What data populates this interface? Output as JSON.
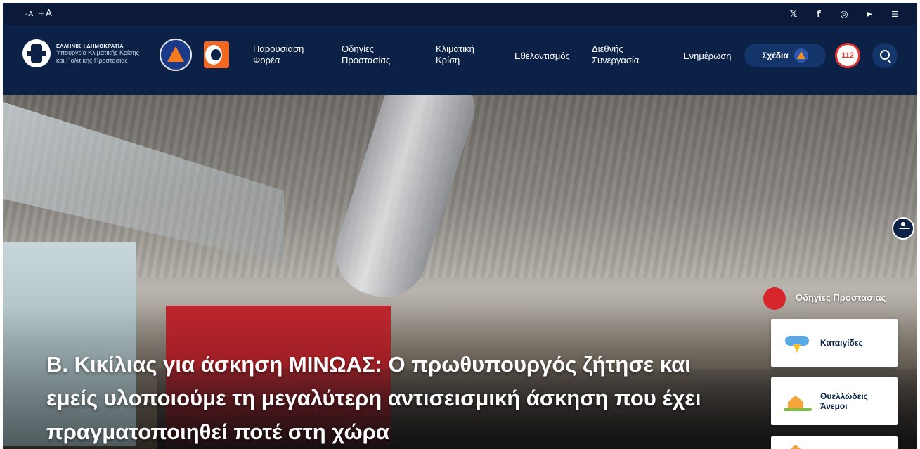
{
  "topbar": {
    "font_decrease": "-A",
    "font_increase": "+A",
    "social": {
      "x": "𝕏",
      "facebook": "f",
      "instagram": "◎",
      "youtube": "▶",
      "rss": "☰"
    }
  },
  "header": {
    "ministry_line1": "ΕΛΛΗΝΙΚΗ ΔΗΜΟΚΡΑΤΙΑ",
    "ministry_line2": "Υπουργείο Κλιματικής Κρίσης",
    "ministry_line3": "και Πολιτικής Προστασίας",
    "menu": [
      {
        "line1": "Παρουσίαση",
        "line2": "Φορέα"
      },
      {
        "line1": "Οδηγίες",
        "line2": "Προστασίας"
      },
      {
        "line1": "Κλιματική",
        "line2": "Κρίση"
      },
      {
        "line1": "Εθελοντισμός",
        "line2": ""
      },
      {
        "line1": "Διεθνής",
        "line2": "Συνεργασία"
      },
      {
        "line1": "Ενημέρωση",
        "line2": ""
      }
    ],
    "plans_label": "Σχέδια",
    "emergency_label": "112"
  },
  "hero": {
    "headline": "Β. Κικίλιας για άσκηση ΜΙΝΩΑΣ: Ο πρωθυπουργός ζήτησε και εμείς υλοποιούμε τη μεγαλύτερη αντισεισμική άσκηση που έχει πραγματοποιηθεί ποτέ στη χώρα"
  },
  "guide": {
    "title": "Οδηγίες Προστασίας",
    "items": [
      {
        "line1": "Καταιγίδες",
        "line2": ""
      },
      {
        "line1": "Θυελλώδεις",
        "line2": "Άνεμοι"
      }
    ]
  },
  "colors": {
    "topbar": "#0a1a38",
    "nav": "#0b2246",
    "accent_red": "#d7262b",
    "accent_orange": "#f47b20"
  }
}
